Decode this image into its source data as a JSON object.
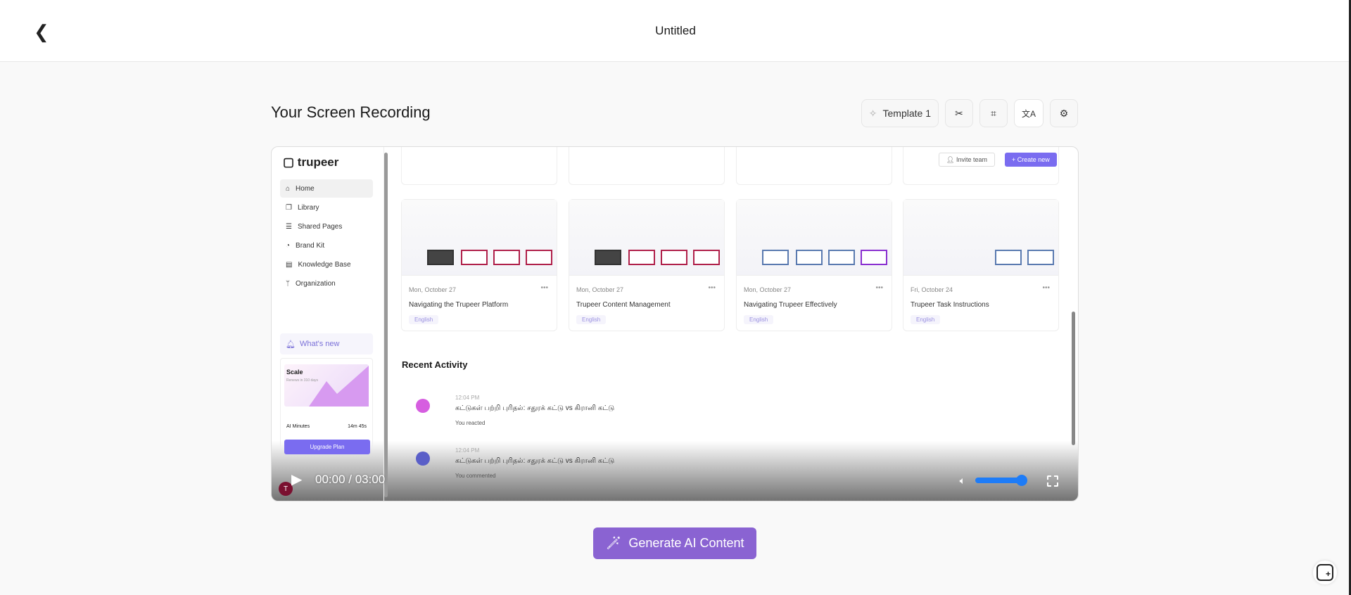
{
  "header": {
    "back_icon": "chevron-left-icon",
    "title": "Untitled"
  },
  "section_title": "Your Screen Recording",
  "toolbar": {
    "template_label": "Template 1",
    "icons": [
      "sparkle-icon",
      "scissors-icon",
      "crop-icon",
      "translate-icon",
      "gear-icon"
    ]
  },
  "recording": {
    "logo": "trupeer",
    "nav": [
      "Home",
      "Library",
      "Shared Pages",
      "Brand Kit",
      "Knowledge Base",
      "Organization"
    ],
    "whats_new": "What's new",
    "plan": {
      "name": "Scale",
      "renew": "Renews in 310 days",
      "ai_minutes_label": "AI Minutes",
      "ai_minutes_value": "14m 45s",
      "upgrade": "Upgrade Plan"
    },
    "user_initial": "T",
    "invite": "Invite team",
    "create": "+ Create new",
    "cards": [
      {
        "date": "Mon, October 27",
        "title": "Navigating the Trupeer Platform",
        "tag": "English"
      },
      {
        "date": "Mon, October 27",
        "title": "Trupeer Content Management",
        "tag": "English"
      },
      {
        "date": "Mon, October 27",
        "title": "Navigating Trupeer Effectively",
        "tag": "English"
      },
      {
        "date": "Fri, October 24",
        "title": "Trupeer Task Instructions",
        "tag": "English"
      }
    ],
    "recent_activity": "Recent Activity",
    "activities": [
      {
        "time": "12:04 PM",
        "text": "கட்டுகள் பற்றி புரிதல்: சதுரக் கட்டு vs கிரானி கட்டு",
        "sub": "You reacted",
        "color": "#d65ee0"
      },
      {
        "time": "12:04 PM",
        "text": "கட்டுகள் பற்றி புரிதல்: சதுரக் கட்டு vs கிரானி கட்டு",
        "sub": "You commented",
        "color": "#5a5fc8"
      }
    ]
  },
  "player": {
    "time": "00:00 / 03:00",
    "volume": 0.95,
    "progress": 0
  },
  "generate_label": "Generate AI Content"
}
